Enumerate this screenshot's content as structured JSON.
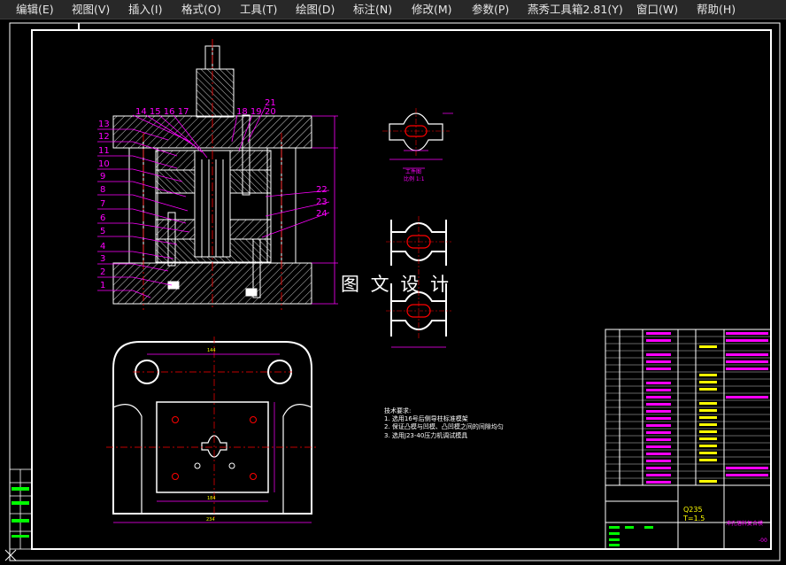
{
  "menu": {
    "items": [
      {
        "id": "edit",
        "label": "编辑(E)"
      },
      {
        "id": "view",
        "label": "视图(V)"
      },
      {
        "id": "insert",
        "label": "插入(I)"
      },
      {
        "id": "format",
        "label": "格式(O)"
      },
      {
        "id": "tools",
        "label": "工具(T)"
      },
      {
        "id": "draw",
        "label": "绘图(D)"
      },
      {
        "id": "dimension",
        "label": "标注(N)"
      },
      {
        "id": "modify",
        "label": "修改(M)"
      },
      {
        "id": "parameters",
        "label": "参数(P)"
      },
      {
        "id": "yanxiu",
        "label": "燕秀工具箱2.81(Y)"
      },
      {
        "id": "window",
        "label": "窗口(W)"
      },
      {
        "id": "help",
        "label": "帮助(H)"
      }
    ]
  },
  "drawing": {
    "watermark": "图 文 设 计",
    "part_numbers_left": [
      "13",
      "12",
      "11",
      "10",
      "9",
      "8",
      "7",
      "6",
      "5",
      "4",
      "3",
      "2",
      "1"
    ],
    "part_numbers_top_left": "14 15 16 17",
    "part_numbers_top_right_a": "18 19",
    "part_numbers_top_right_b": "21",
    "part_numbers_top_right_c": "20",
    "part_numbers_right": [
      "22",
      "23",
      "24"
    ],
    "tech_requirements": {
      "title": "技术要求:",
      "lines": [
        "1. 选用16号后侧导柱标准模架",
        "2. 保证凸模与凹模、凸凹模之间的间隙均匀",
        "3. 选用J23-40压力机调试模具"
      ]
    },
    "part_view_label_1": "工件图",
    "part_view_label_2": "比例 1:1",
    "dims_plan": [
      "144",
      "184",
      "234"
    ],
    "title_block": {
      "material": "Q235",
      "thickness": "T=1.5",
      "drawing_name": "冲孔落料复合模",
      "code": "-00"
    }
  },
  "colors": {
    "menubar_bg": "#282828",
    "menu_text": "#e6e6e6",
    "canvas_bg": "#000000",
    "white_lines": "#ffffff",
    "magenta_dims": "#ff00ff",
    "red_centerlines": "#ff0000",
    "green_fill": "#00ff00"
  },
  "icons": {
    "ucs": "ucs-icon"
  }
}
